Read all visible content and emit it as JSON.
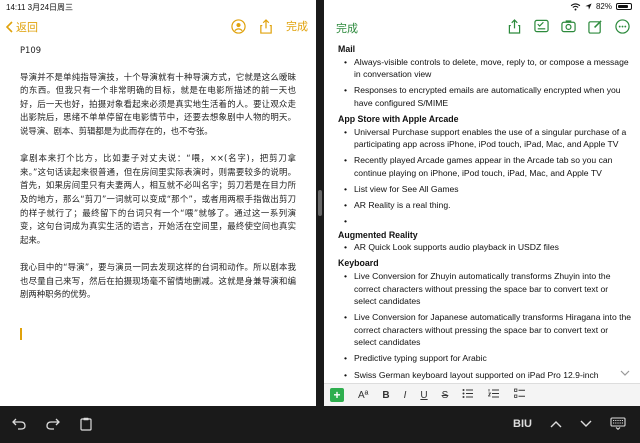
{
  "status": {
    "time": "14:11",
    "date": "3月24日周三",
    "battery": "82%",
    "battery_level": 0.82
  },
  "left": {
    "back_label": "返回",
    "done_label": "完成",
    "title": "P109",
    "paragraphs": [
      "导演并不是单纯指导演技，十个导演就有十种导演方式，它就是这么暧昧的东西。但我只有一个非常明确的目标，就是在电影所描述的前一天也好，后一天也好，拍摄对象看起来必须是真实地生活着的人。要让观众走出影院后，思绪不单单停留在电影情节中，还要去想象剧中人物的明天。说导演、剧本、剪辑都是为此而存在的，也不夸张。",
      "拿剧本来打个比方，比如妻子对丈夫说：“喂，××(名字)，把剪刀拿来。”这句话读起来很普通，但在房间里实际表演时，则需要较多的说明。首先，如果房间里只有夫妻两人，相互就不必叫名字；剪刀若是在目力所及的地方，那么“剪刀”一词就可以变成“那个”，或者用两根手指做出剪刀的样子就行了；最终留下的台词只有一个“喂”就够了。通过这一系列演变，这句台词成为真实生活的语言，开始活在空间里，最终使空间也真实起来。",
      "我心目中的“导演”，要与演员一同去发现这样的台词和动作。所以剧本我也尽量自己来写，然后在拍摄现场毫不留情地删减。这就是身兼导演和编剧两种职务的优势。"
    ]
  },
  "right": {
    "done_label": "完成",
    "sections": [
      {
        "heading": "Mail",
        "items": [
          "Always-visible controls to delete, move, reply to, or compose a message in conversation view",
          "Responses to encrypted emails are automatically encrypted when you have configured S/MIME"
        ]
      },
      {
        "heading": "App Store with Apple Arcade",
        "items": [
          "Universal Purchase support enables the use of a singular purchase of a participating app across iPhone, iPod touch, iPad, Mac, and Apple TV",
          "Recently played Arcade games appear in the Arcade tab so you can continue playing on iPhone, iPod touch, iPad, Mac, and Apple TV",
          "List view for See All Games",
          "AR Reality is a real thing.",
          ""
        ]
      },
      {
        "heading": "Augmented Reality",
        "items": [
          "AR Quick Look supports audio playback in USDZ files"
        ]
      },
      {
        "heading": "Keyboard",
        "items": [
          "Live Conversion for Zhuyin automatically transforms Zhuyin into the correct characters without pressing the space bar to convert text or select candidates",
          "Live Conversion for Japanese automatically transforms Hiragana into the correct characters without pressing the space bar to convert text or select candidates",
          "Predictive typing support for Arabic",
          "Swiss German keyboard layout supported on iPad Pro 12.9-inch"
        ]
      }
    ],
    "format_bar": {
      "plus": "+",
      "aa": "Aª",
      "bold": "B",
      "italic": "I",
      "underline": "U",
      "strike": "S"
    }
  },
  "bottom_bar": {
    "bold_italic_underline": "BIU"
  },
  "colors": {
    "accent_yellow": "#e0a20c",
    "accent_green": "#2c8a3c"
  }
}
